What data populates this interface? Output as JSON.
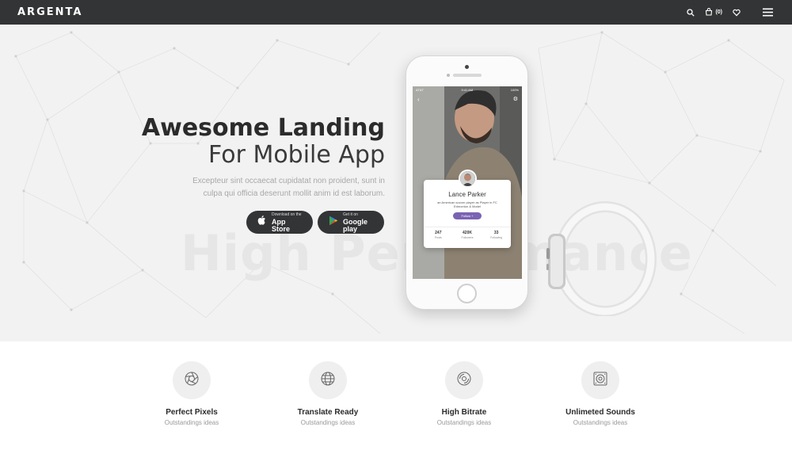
{
  "header": {
    "logo": "ARGENTA",
    "cart_count": "(0)",
    "icons": [
      "search-icon",
      "cart-icon",
      "heart-icon",
      "menu-icon"
    ]
  },
  "hero": {
    "title_line1": "Awesome Landing",
    "title_line2": "For Mobile App",
    "subtitle_line1": "Excepteur sint occaecat cupidatat non proident, sunt in",
    "subtitle_line2": "culpa qui officia deserunt mollit anim id est laborum.",
    "watermark": "High Performance",
    "app_store": {
      "small": "Download on the",
      "big": "App Store"
    },
    "google_play": {
      "small": "Get it on",
      "big": "Google play"
    }
  },
  "phone": {
    "carrier": "AT&T",
    "time": "9:41 AM",
    "battery": "100%",
    "profile_name": "Lance Parker",
    "profile_desc": "an American soccer player as Player in FC Edmonton & Model",
    "follow_label": "Follow +",
    "stats": [
      {
        "value": "247",
        "label": "Posts"
      },
      {
        "value": "420K",
        "label": "Followers"
      },
      {
        "value": "33",
        "label": "Following"
      }
    ]
  },
  "features": [
    {
      "icon": "aperture-icon",
      "title": "Perfect Pixels",
      "subtitle": "Outstandings ideas"
    },
    {
      "icon": "globe-icon",
      "title": "Translate Ready",
      "subtitle": "Outstandings ideas"
    },
    {
      "icon": "disc-icon",
      "title": "High Bitrate",
      "subtitle": "Outstandings ideas"
    },
    {
      "icon": "speaker-icon",
      "title": "Unlimeted Sounds",
      "subtitle": "Outstandings ideas"
    }
  ],
  "colors": {
    "header_bg": "#333436",
    "hero_bg": "#f2f2f2",
    "accent": "#7a63b3"
  }
}
